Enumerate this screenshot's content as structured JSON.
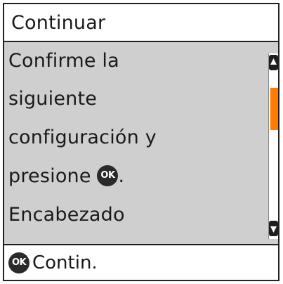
{
  "title": "Continuar",
  "message": {
    "lines": [
      "Confirme la",
      "siguiente",
      "configuración y",
      "presione",
      "Encabezado"
    ],
    "suffix_after_ok": "."
  },
  "icons": {
    "ok": "OK",
    "scroll_up": "scroll-up-arrow-icon",
    "scroll_down": "scroll-down-arrow-icon"
  },
  "scroll": {
    "position_fraction": 0.15
  },
  "bottom_action": {
    "label": "Contin."
  },
  "colors": {
    "panel": "#cfcfcf",
    "scroll_thumb": "#ff7a00",
    "ok_icon": "#2a2a2a"
  }
}
